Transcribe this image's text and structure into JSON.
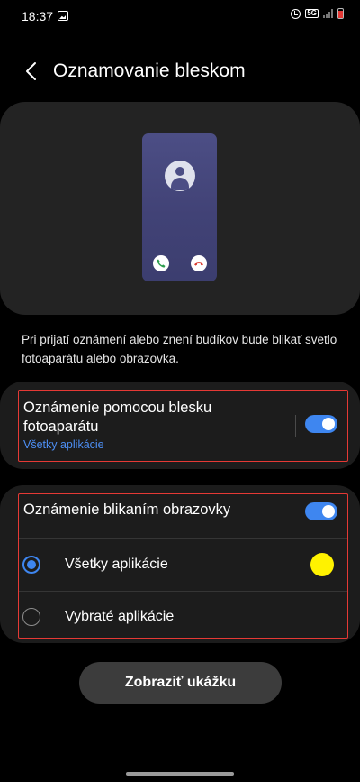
{
  "status_bar": {
    "time": "18:37",
    "network_badge": "5G",
    "icons": [
      "gallery-icon",
      "alarm-icon",
      "signal-icon",
      "battery-icon"
    ],
    "battery_color": "#e53935"
  },
  "header": {
    "title": "Oznamovanie bleskom",
    "back_icon": "chevron-left-icon"
  },
  "preview": {
    "icons": [
      "avatar-icon",
      "accept-call-icon",
      "decline-call-icon"
    ],
    "accept_color": "#2e9e4f",
    "decline_color": "#d93a2f"
  },
  "description": "Pri prijatí oznámení alebo znení budíkov bude blikať svetlo fotoaparátu alebo obrazovka.",
  "camera_flash": {
    "title": "Oznámenie pomocou blesku fotoaparátu",
    "subtitle": "Všetky aplikácie",
    "enabled": true
  },
  "screen_flash": {
    "title": "Oznámenie blikaním obrazovky",
    "enabled": true,
    "options": [
      {
        "label": "Všetky aplikácie",
        "selected": true
      },
      {
        "label": "Vybraté aplikácie",
        "selected": false
      }
    ],
    "selected_color": "#fff200"
  },
  "preview_button": "Zobraziť ukážku",
  "colors": {
    "accent": "#3e86f0",
    "link": "#4d8ff5",
    "highlight_box": "#e53935"
  }
}
